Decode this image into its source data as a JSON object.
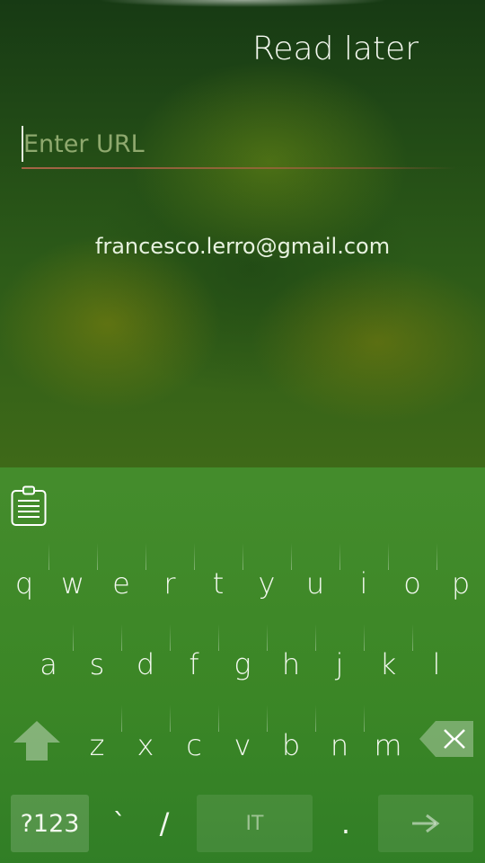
{
  "page": {
    "title": "Read later",
    "url_field": {
      "value": "",
      "placeholder": "Enter URL"
    },
    "account_email": "francesco.lerro@gmail.com"
  },
  "keyboard": {
    "clipboard_icon": "clipboard-icon",
    "row1": [
      "q",
      "w",
      "e",
      "r",
      "t",
      "y",
      "u",
      "i",
      "o",
      "p"
    ],
    "row2": [
      "a",
      "s",
      "d",
      "f",
      "g",
      "h",
      "j",
      "k",
      "l"
    ],
    "row3": [
      "z",
      "x",
      "c",
      "v",
      "b",
      "n",
      "m"
    ],
    "bottom": {
      "symbols_label": "?123",
      "backtick_label": "`",
      "slash_label": "/",
      "space_label": "IT",
      "period_label": "."
    },
    "shift_icon": "shift-arrow-icon",
    "backspace_icon": "backspace-icon",
    "enter_icon": "arrow-right-icon"
  },
  "colors": {
    "accent_underline": "#c86a58",
    "keyboard_bg": "#3f8c2c"
  }
}
